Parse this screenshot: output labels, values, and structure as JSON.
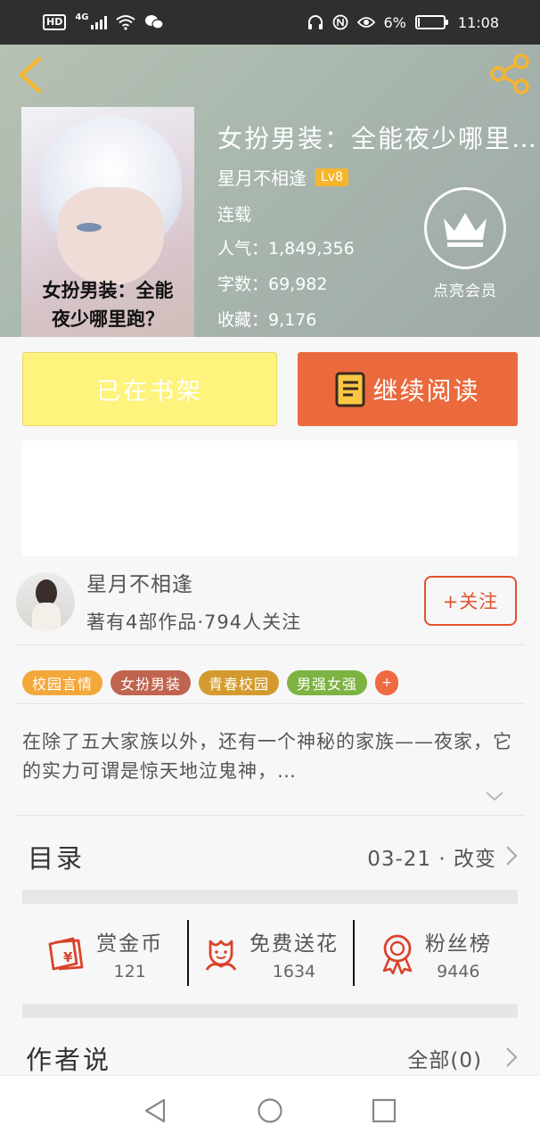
{
  "status_bar": {
    "hd_label": "HD",
    "network_label": "4G",
    "battery_percent": "6%",
    "battery_level": 0.06,
    "time": "11:08",
    "icons": [
      "signal-icon",
      "wifi-icon",
      "wechat-icon",
      "headphones-icon",
      "nfc-icon",
      "eye-icon",
      "battery-icon"
    ]
  },
  "header": {
    "back_icon": "chevron-left-icon",
    "share_icon": "share-icon",
    "accent_color": "#f6b52d"
  },
  "book": {
    "cover_text": "女扮男装：全能\n夜少哪里跑？",
    "title": "女扮男装：全能夜少哪里跑？",
    "author": "星月不相逢",
    "level": "Lv8",
    "status": "连载",
    "popularity": "人气：1,849,356",
    "word_count": "字数：69,982",
    "favorites": "收藏：9,176",
    "vip_label": "点亮会员",
    "vip_icon": "crown-icon"
  },
  "actions": {
    "on_shelf_label": "已在书架",
    "continue_label": "继续阅读",
    "continue_icon": "book-icon",
    "continue_color": "#ea6a3d",
    "shelf_color": "#fef37d"
  },
  "author_card": {
    "name": "星月不相逢",
    "stats": "著有4部作品·794人关注",
    "follow_label": "+关注"
  },
  "tags": [
    {
      "label": "校园言情",
      "color": "#f3a83b"
    },
    {
      "label": "女扮男装",
      "color": "#c0644f"
    },
    {
      "label": "青春校园",
      "color": "#d49a2e"
    },
    {
      "label": "男强女强",
      "color": "#7cb342"
    }
  ],
  "tags_more": "+",
  "synopsis": "在除了五大家族以外，还有一个神秘的家族——夜家，它的实力可谓是惊天地泣鬼神，…",
  "catalog": {
    "title": "目录",
    "update": "03-21 · 改变"
  },
  "stats": [
    {
      "label": "赏金币",
      "value": "121",
      "icon": "red-envelope-icon"
    },
    {
      "label": "免费送花",
      "value": "1634",
      "icon": "flower-icon"
    },
    {
      "label": "粉丝榜",
      "value": "9446",
      "icon": "medal-icon"
    }
  ],
  "author_say": {
    "title": "作者说",
    "all_label": "全部(0)"
  },
  "nav": {
    "icons": [
      "nav-back-icon",
      "nav-home-icon",
      "nav-recents-icon"
    ]
  }
}
